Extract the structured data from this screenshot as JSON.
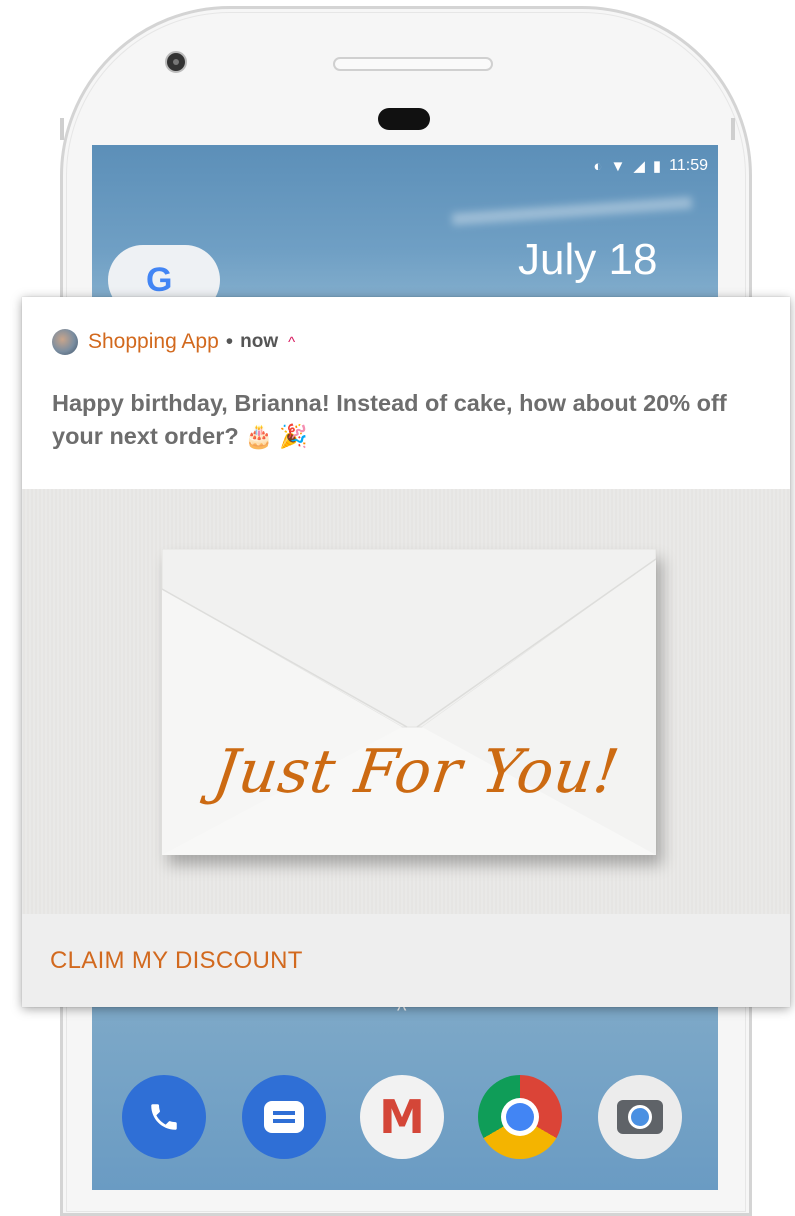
{
  "status_bar": {
    "icons": [
      "data-saver-icon",
      "wifi-icon",
      "signal-icon",
      "battery-icon"
    ],
    "time": "11:59"
  },
  "home_screen": {
    "google_logo": "G",
    "date": "July 18"
  },
  "notification": {
    "app_name": "Shopping App",
    "separator": "•",
    "time": "now",
    "expand_glyph": "^",
    "message": "Happy birthday, Brianna! Instead of cake, how about 20% off your next order?",
    "emojis": [
      "birthday-cake-icon",
      "party-popper-icon"
    ],
    "image_text": "Just For You!",
    "action_label": "CLAIM MY DISCOUNT",
    "accent_color": "#d2691e"
  },
  "dock": {
    "chevron": "^",
    "apps": [
      "phone-app-icon",
      "messages-app-icon",
      "gmail-app-icon",
      "chrome-app-icon",
      "camera-app-icon"
    ]
  }
}
